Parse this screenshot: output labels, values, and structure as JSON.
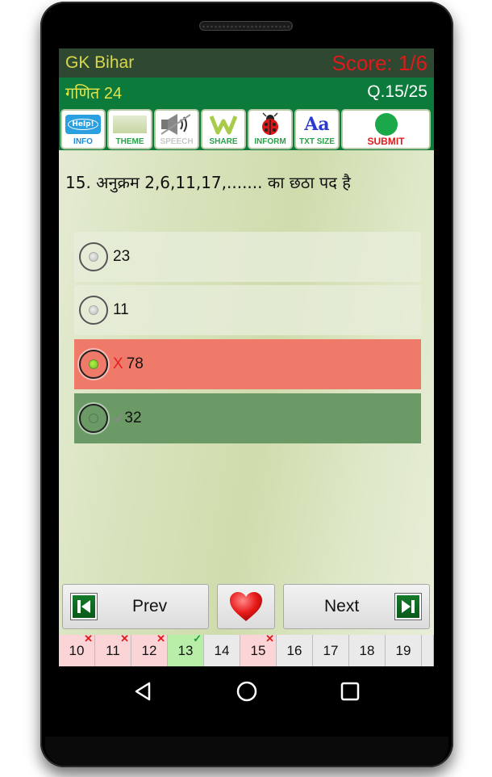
{
  "header": {
    "app_title": "GK Bihar",
    "score": "Score: 1/6",
    "subject": "गणित 24",
    "question_counter": "Q.15/25"
  },
  "toolbar": {
    "items": [
      {
        "label": "INFO",
        "icon": "help-bubble-icon",
        "icon_text": "Help!",
        "color": "#1a8ad8"
      },
      {
        "label": "THEME",
        "icon": "theme-swatch-icon",
        "color": "#2aa04a"
      },
      {
        "label": "SPEECH",
        "icon": "speaker-muted-icon",
        "color": "#c8c8c8"
      },
      {
        "label": "SHARE",
        "icon": "share-w-icon",
        "color": "#2aa04a"
      },
      {
        "label": "INFORM",
        "icon": "ladybug-icon",
        "color": "#2aa04a"
      },
      {
        "label": "TXT SIZE",
        "icon": "text-size-icon",
        "icon_text": "Aa",
        "color": "#2aa04a"
      },
      {
        "label": "SUBMIT",
        "icon": "green-dot-icon",
        "color": "#e01a1a"
      }
    ]
  },
  "question": {
    "text": "15. अनुक्रम 2,6,11,17,....... का छठा पद है"
  },
  "options": [
    {
      "text": "23",
      "state": "neutral",
      "selected": false,
      "mark": ""
    },
    {
      "text": "11",
      "state": "neutral",
      "selected": false,
      "mark": ""
    },
    {
      "text": "78",
      "state": "wrong",
      "selected": true,
      "mark": "X"
    },
    {
      "text": "32",
      "state": "correct",
      "selected": false,
      "mark": "✔"
    }
  ],
  "navigation": {
    "prev_label": "Prev",
    "next_label": "Next",
    "favorite_icon": "heart-icon"
  },
  "question_strip": [
    {
      "num": "10",
      "status": "wrong",
      "flag": "✕"
    },
    {
      "num": "11",
      "status": "wrong",
      "flag": "✕"
    },
    {
      "num": "12",
      "status": "wrong",
      "flag": "✕"
    },
    {
      "num": "13",
      "status": "right",
      "flag": "✓"
    },
    {
      "num": "14",
      "status": "none",
      "flag": ""
    },
    {
      "num": "15",
      "status": "wrong",
      "flag": "✕"
    },
    {
      "num": "16",
      "status": "none",
      "flag": ""
    },
    {
      "num": "17",
      "status": "none",
      "flag": ""
    },
    {
      "num": "18",
      "status": "none",
      "flag": ""
    },
    {
      "num": "19",
      "status": "none",
      "flag": ""
    }
  ],
  "colors": {
    "top_bar": "#2e4832",
    "sub_bar": "#0b7a3a",
    "score": "#e01a1a",
    "title": "#d8d84a",
    "wrong_option": "#f07a6a",
    "correct_option": "#6b9a66"
  }
}
